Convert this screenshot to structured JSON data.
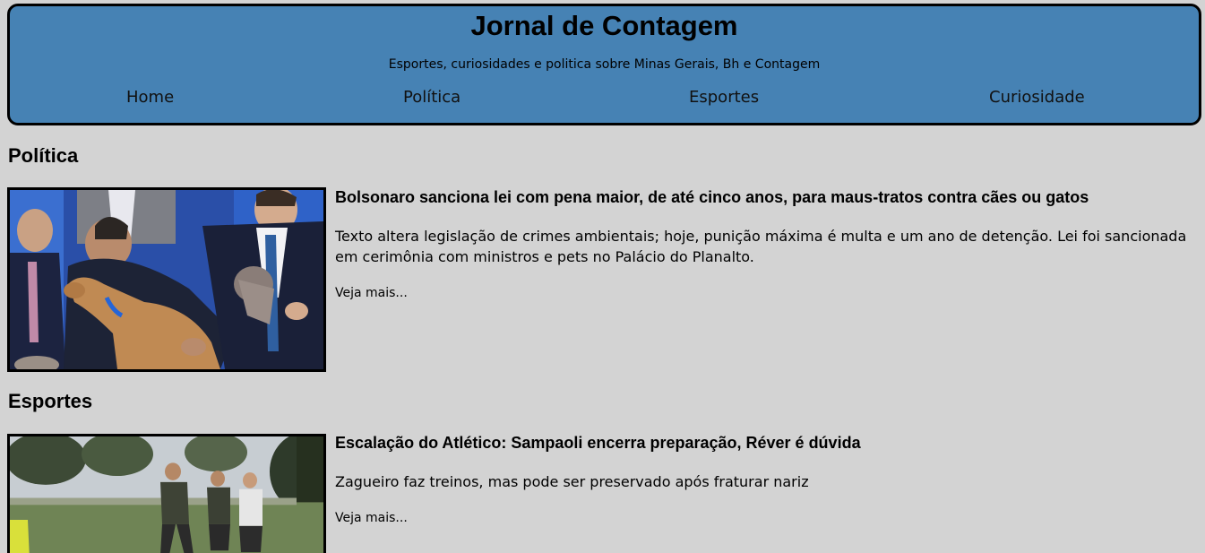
{
  "header": {
    "title": "Jornal de Contagem",
    "subtitle": "Esportes, curiosidades e politica sobre Minas Gerais, Bh e Contagem",
    "nav": [
      {
        "label": "Home"
      },
      {
        "label": "Política"
      },
      {
        "label": "Esportes"
      },
      {
        "label": "Curiosidade"
      }
    ]
  },
  "sections": [
    {
      "heading": "Política",
      "article": {
        "title": "Bolsonaro sanciona lei com pena maior, de até cinco anos, para maus-tratos contra cães ou gatos",
        "summary": "Texto altera legislação de crimes ambientais; hoje, punição máxima é multa e um ano de detenção. Lei foi sancionada em cerimônia com ministros e pets no Palácio do Planalto.",
        "read_more": "Veja mais..."
      }
    },
    {
      "heading": "Esportes",
      "article": {
        "title": "Escalação do Atlético: Sampaoli encerra preparação, Réver é dúvida",
        "summary": "Zagueiro faz treinos, mas pode ser preservado após fraturar nariz",
        "read_more": "Veja mais..."
      }
    }
  ],
  "colors": {
    "page_background": "#d3d3d3",
    "header_background": "#4682b4",
    "border": "#000000"
  }
}
